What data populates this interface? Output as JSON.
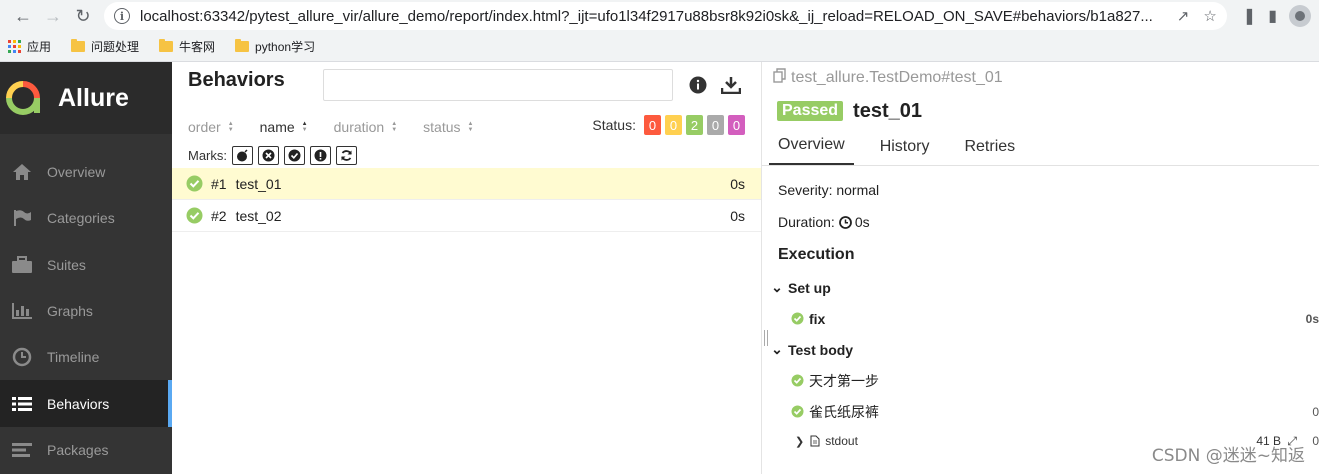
{
  "browser": {
    "url": "localhost:63342/pytest_allure_vir/allure_demo/report/index.html?_ijt=ufo1l34f2917u88bsr8k92i0sk&_ij_reload=RELOAD_ON_SAVE#behaviors/b1a827...",
    "bookmarks": [
      {
        "label": "应用",
        "kind": "apps"
      },
      {
        "label": "问题处理",
        "kind": "folder"
      },
      {
        "label": "牛客网",
        "kind": "folder"
      },
      {
        "label": "python学习",
        "kind": "folder"
      }
    ]
  },
  "sidebar": {
    "brand": "Allure",
    "items": [
      {
        "label": "Overview",
        "icon": "home-icon"
      },
      {
        "label": "Categories",
        "icon": "flag-icon"
      },
      {
        "label": "Suites",
        "icon": "briefcase-icon"
      },
      {
        "label": "Graphs",
        "icon": "bar-chart-icon"
      },
      {
        "label": "Timeline",
        "icon": "clock-icon"
      },
      {
        "label": "Behaviors",
        "icon": "list-icon",
        "active": true
      },
      {
        "label": "Packages",
        "icon": "align-left-icon"
      }
    ]
  },
  "list": {
    "title": "Behaviors",
    "search_value": "",
    "sort": [
      {
        "label": "order",
        "active": false
      },
      {
        "label": "name",
        "active": true
      },
      {
        "label": "duration",
        "active": false
      },
      {
        "label": "status",
        "active": false
      }
    ],
    "status_label": "Status:",
    "status_counts": [
      {
        "value": "0",
        "color": "#fd5a3e"
      },
      {
        "value": "0",
        "color": "#ffd050"
      },
      {
        "value": "2",
        "color": "#97cc64"
      },
      {
        "value": "0",
        "color": "#aaaaaa"
      },
      {
        "value": "0",
        "color": "#d35ebe"
      }
    ],
    "marks_label": "Marks:",
    "rows": [
      {
        "num": "#1",
        "name": "test_01",
        "duration": "0s",
        "selected": true
      },
      {
        "num": "#2",
        "name": "test_02",
        "duration": "0s",
        "selected": false
      }
    ]
  },
  "detail": {
    "breadcrumb": "test_allure.TestDemo#test_01",
    "status_badge": "Passed",
    "title": "test_01",
    "tabs": [
      {
        "label": "Overview",
        "active": true
      },
      {
        "label": "History",
        "active": false
      },
      {
        "label": "Retries",
        "active": false
      }
    ],
    "severity": "Severity: normal",
    "duration_label": "Duration:",
    "duration_value": "0s",
    "execution_title": "Execution",
    "setup_label": "Set up",
    "setup_step": "fix",
    "setup_step_time": "0s",
    "body_label": "Test body",
    "body_steps": [
      {
        "label": "天才第一步",
        "time": ""
      },
      {
        "label": "雀氏纸尿裤",
        "time": "0"
      }
    ],
    "attachment_name": "stdout",
    "attachment_size": "41 B",
    "attachment_time": "0"
  },
  "watermark": "CSDN @迷迷~知返",
  "colors": {
    "passed": "#97cc64",
    "sidebar_bg": "#343434",
    "accent": "#5aa9f2"
  }
}
